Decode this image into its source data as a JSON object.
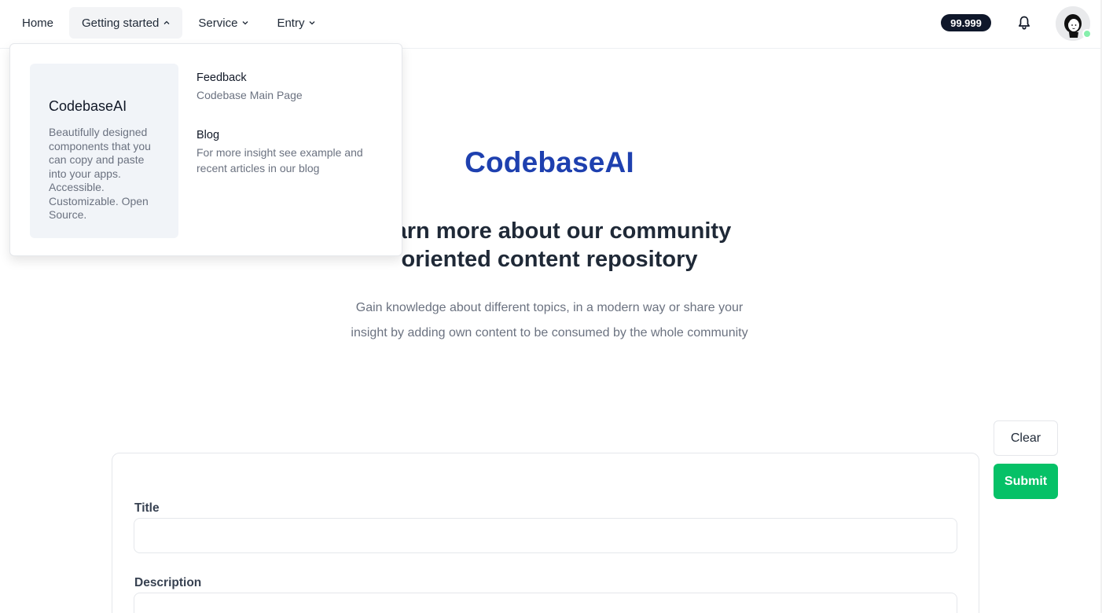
{
  "nav": {
    "items": [
      {
        "label": "Home",
        "has_dropdown": false,
        "active": false
      },
      {
        "label": "Getting started",
        "has_dropdown": true,
        "active": true,
        "expanded": true
      },
      {
        "label": "Service",
        "has_dropdown": true,
        "active": false
      },
      {
        "label": "Entry",
        "has_dropdown": true,
        "active": false
      }
    ]
  },
  "header": {
    "badge_value": "99.999",
    "bell_icon": "bell-icon",
    "avatar_status_color": "#86efac"
  },
  "dropdown": {
    "feature": {
      "title": "CodebaseAI",
      "description": "Beautifully designed components that you can copy and paste into your apps. Accessible. Customizable. Open Source."
    },
    "links": [
      {
        "title": "Feedback",
        "description": "Codebase Main Page"
      },
      {
        "title": "Blog",
        "description": "For more insight see example and recent articles in our blog"
      }
    ]
  },
  "hero": {
    "brand": "CodebaseAI",
    "heading_line1": "Learn more about our community",
    "heading_line2": "oriented content repository",
    "sub_line1": "Gain knowledge about different topics, in a modern way or share your",
    "sub_line2": "insight by adding own content to be consumed by the whole community"
  },
  "form": {
    "title_label": "Title",
    "title_value": "",
    "description_label": "Description",
    "description_value": ""
  },
  "actions": {
    "clear_label": "Clear",
    "submit_label": "Submit"
  },
  "colors": {
    "brand": "#1e40af",
    "submit": "#06c167",
    "badge_bg": "#0f172a"
  }
}
